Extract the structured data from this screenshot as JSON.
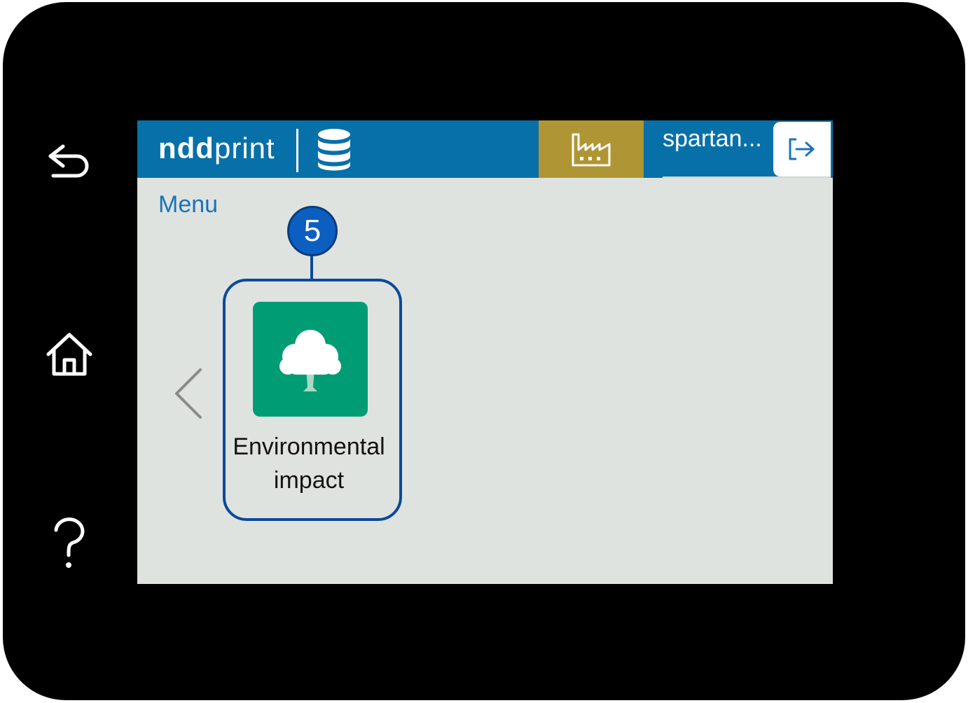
{
  "device": {
    "buttons": {
      "back_icon": "back-arrow-icon",
      "home_icon": "home-icon",
      "help_icon": "help-icon"
    }
  },
  "header": {
    "logo_bold": "ndd",
    "logo_rest": "print",
    "database_icon": "database-icon",
    "factory_icon": "factory-icon",
    "username": "spartan...",
    "logout_icon": "logout-icon",
    "colors": {
      "bar": "#0870a8",
      "factory_tile": "#b09534"
    }
  },
  "main": {
    "menu_label": "Menu",
    "prev_icon": "chevron-left-icon",
    "tiles": [
      {
        "label_line1": "Environmental",
        "label_line2": "impact",
        "icon": "tree-icon",
        "color": "#009d74"
      }
    ]
  },
  "callout": {
    "number": "5",
    "color": "#0a4a9a"
  }
}
